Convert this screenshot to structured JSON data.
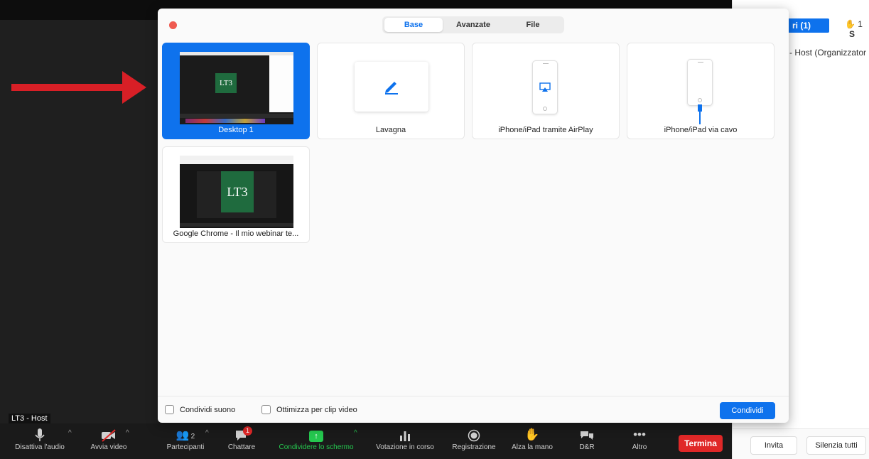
{
  "side_panel": {
    "tab_label": "ri (1)",
    "hand_count": "1",
    "s_label": "S",
    "host_row": "- Host (Organizzator",
    "invite_label": "Invita",
    "mute_all_label": "Silenzia tutti"
  },
  "meeting": {
    "host_name_label": "LT3 - Host"
  },
  "dialog": {
    "tabs": [
      {
        "label": "Base"
      },
      {
        "label": "Avanzate"
      },
      {
        "label": "File"
      }
    ],
    "cards": [
      {
        "label": "Desktop 1",
        "logo": "LT3"
      },
      {
        "label": "Lavagna"
      },
      {
        "label": "iPhone/iPad tramite AirPlay"
      },
      {
        "label": "iPhone/iPad via cavo"
      },
      {
        "label": "Google Chrome - Il mio webinar te...",
        "logo": "LT3"
      }
    ],
    "footer": {
      "share_sound_label": "Condividi suono",
      "optimize_clip_label": "Ottimizza per clip video",
      "share_button_label": "Condividi"
    }
  },
  "toolbar": {
    "mute_audio": "Disattiva l'audio",
    "start_video": "Avvia video",
    "participants": "Partecipanti",
    "participants_count": "2",
    "chat": "Chattare",
    "chat_badge": "1",
    "share_screen": "Condividere lo schermo",
    "polling": "Votazione in corso",
    "record": "Registrazione",
    "raise_hand": "Alza la mano",
    "qa": "D&R",
    "more": "Altro",
    "end": "Termina"
  },
  "colors": {
    "accent": "#0e72ed",
    "end_button": "#e02828",
    "share_green": "#25c84f",
    "arrow_red": "#d81f26"
  }
}
